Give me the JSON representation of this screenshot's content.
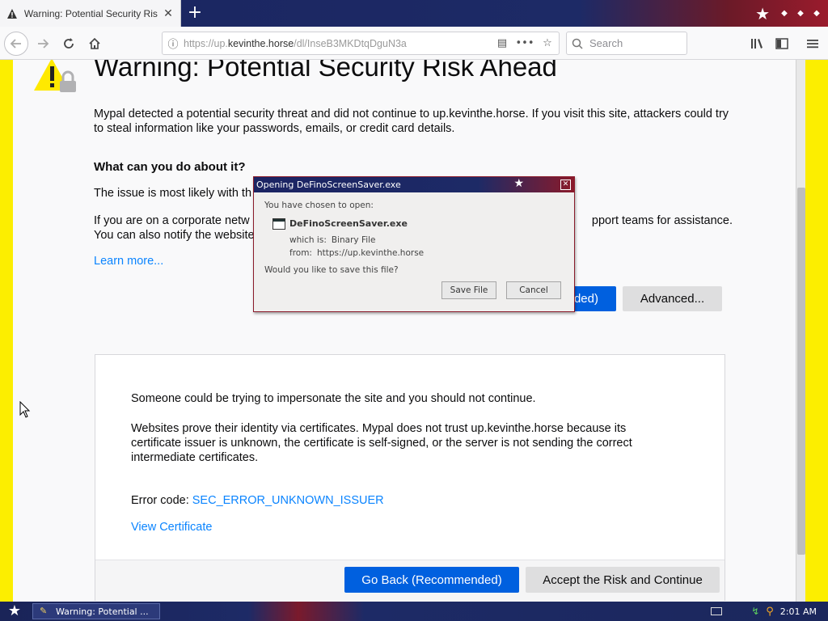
{
  "browser": {
    "tab": {
      "title": "Warning: Potential Security Risk A",
      "close_glyph": "✕"
    },
    "newtab_glyph": "+",
    "url": {
      "prefix": "https://up.",
      "host": "kevinthe.horse",
      "path": "/dl/InseB3MKDtqDguN3a"
    },
    "search": {
      "placeholder": "Search"
    }
  },
  "page": {
    "title": "Warning: Potential Security Risk Ahead",
    "intro": "Mypal detected a potential security threat and did not continue to up.kevinthe.horse. If you visit this site, attackers could try to steal information like your passwords, emails, or credit card details.",
    "what_heading": "What can you do about it?",
    "issue_visible": "The issue is most likely with th",
    "corp_visible_left": "If you are on a corporate netw",
    "corp_visible_right": "pport teams for assistance.",
    "corp_line2": "You can also notify the website",
    "learn_more": "Learn more...",
    "goback_top_label": "ded)",
    "advanced_label": "Advanced...",
    "details": {
      "p1": "Someone could be trying to impersonate the site and you should not continue.",
      "p2": "Websites prove their identity via certificates. Mypal does not trust up.kevinthe.horse because its certificate issuer is unknown, the certificate is self-signed, or the server is not sending the correct intermediate certificates.",
      "error_label": "Error code: ",
      "error_code": "SEC_ERROR_UNKNOWN_ISSUER",
      "view_cert": "View Certificate",
      "goback": "Go Back (Recommended)",
      "accept": "Accept the Risk and Continue"
    }
  },
  "dialog": {
    "title": "Opening DeFinoScreenSaver.exe",
    "chosen": "You have chosen to open:",
    "filename": "DeFinoScreenSaver.exe",
    "which_label": "which is:",
    "which_value": "Binary File",
    "from_label": "from:",
    "from_value": "https://up.kevinthe.horse",
    "save_question": "Would you like to save this file?",
    "save_button": "Save File",
    "cancel_button": "Cancel"
  },
  "taskbar": {
    "task_label": "Warning: Potential ...",
    "clock": "2:01 AM"
  },
  "colors": {
    "link": "#0a84ff",
    "primary_button": "#0060df",
    "page_border": "#fcee00"
  }
}
